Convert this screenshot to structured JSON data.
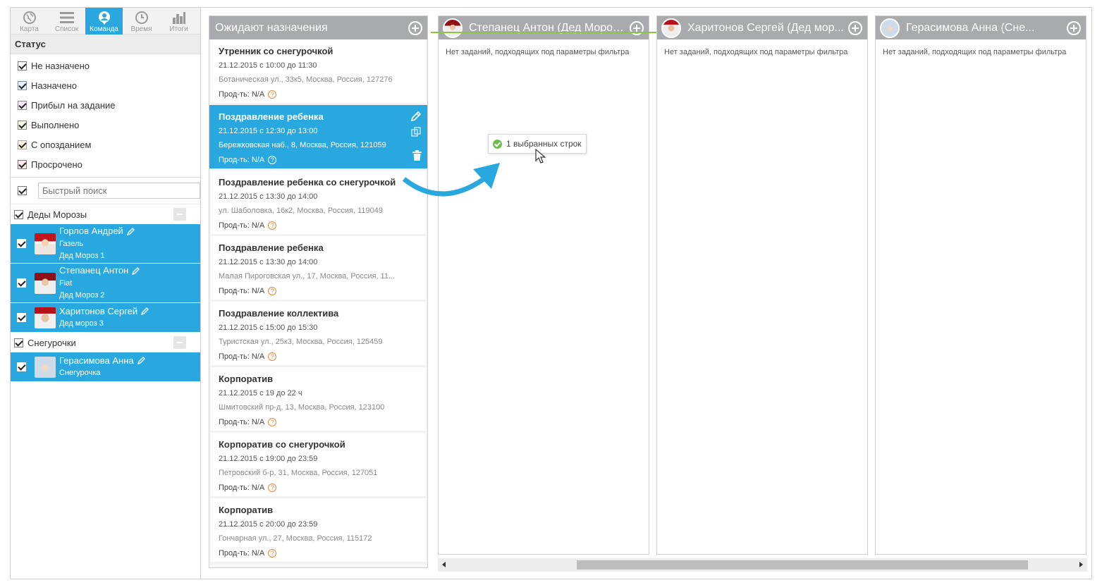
{
  "nav": [
    {
      "label": "Карта",
      "icon": "globe-icon",
      "active": false
    },
    {
      "label": "Список",
      "icon": "list-icon",
      "active": false
    },
    {
      "label": "Команда",
      "icon": "team-pin-icon",
      "active": true
    },
    {
      "label": "Время",
      "icon": "clock-icon",
      "active": false
    },
    {
      "label": "Итоги",
      "icon": "bar-chart-icon",
      "active": false
    }
  ],
  "status": {
    "title": "Статус",
    "items": [
      {
        "label": "Не назначено",
        "color": "#333333"
      },
      {
        "label": "Назначено",
        "color": "#4a9ad4"
      },
      {
        "label": "Прибыл на задание",
        "color": "#a86bbf"
      },
      {
        "label": "Выполнено",
        "color": "#63a63c"
      },
      {
        "label": "С опозданием",
        "color": "#d2a62a"
      },
      {
        "label": "Просрочено",
        "color": "#d24c4c"
      }
    ]
  },
  "search": {
    "placeholder": "Быстрый поиск"
  },
  "groups": [
    {
      "label": "Деды Морозы"
    },
    {
      "label": "Снегурочки"
    }
  ],
  "people": [
    {
      "name": "Горлов Андрей",
      "vehicle": "Газель",
      "role": "Дед Мороз 1"
    },
    {
      "name": "Степанец Антон",
      "vehicle": "Fiat",
      "role": "Дед Мороз 2"
    },
    {
      "name": "Харитонов Сергей",
      "role": "Дед мороз 3"
    },
    {
      "name": "Герасимова Анна",
      "role": "Снегурочка"
    }
  ],
  "pending": {
    "title": "Ожидают назначения",
    "productivity_prefix": "Прод-ть: N/A",
    "tasks": [
      {
        "title": "Утренник со снегурочкой",
        "date": "21.12.2015 с 10:00 до 11:30",
        "address": "Ботаническая ул., 33к5, Москва, Россия, 127276"
      },
      {
        "title": "Поздравление ребенка",
        "date": "21.12.2015 с 12:30 до 13:00",
        "address": "Бережковская наб., 8, Москва, Россия, 121059",
        "selected": true
      },
      {
        "title": "Поздравление ребенка со снегурочкой",
        "date": "21.12.2015 с 13:30 до 14:00",
        "address": "ул. Шаболовка, 16к2, Москва, Россия, 119049"
      },
      {
        "title": "Поздравление ребенка",
        "date": "21.12.2015 с 13:30 до 14:00",
        "address": "Малая Пироговская ул., 17, Москва, Россия, 11..."
      },
      {
        "title": "Поздравление коллектива",
        "date": "21.12.2015 с 15:00 до 15:30",
        "address": "Туристская ул., 25к3, Москва, Россия, 125459"
      },
      {
        "title": "Корпоратив",
        "date": "21.12.2015 с 19 до 22 ч",
        "address": "Шмитовский пр-д, 13, Москва, Россия, 123100"
      },
      {
        "title": "Корпоратив со снегурочкой",
        "date": "21.12.2015 с 19:00 до 23:59",
        "address": "Петровский б-р, 31, Москва, Россия, 127051"
      },
      {
        "title": "Корпоратив",
        "date": "21.12.2015 с 20:00 до 23:59",
        "address": "Гончарная ул., 27, Москва, Россия, 115172"
      }
    ]
  },
  "agents": [
    {
      "title": "Степанец Антон (Дед Мороз ...",
      "empty": "Нет заданий, подходящих под параметры фильтра"
    },
    {
      "title": "Харитонов Сергей (Дед мор...",
      "empty": "Нет заданий, подходящих под параметры фильтра"
    },
    {
      "title": "Герасимова Анна (Сне...",
      "empty": "Нет заданий, подходящих под параметры фильтра"
    }
  ],
  "drag": {
    "label": "1 выбранных строк"
  },
  "colors": {
    "accent": "#29a8e0",
    "header_gray": "#a9aaad",
    "drag_arrow": "#29a8e0",
    "drop_line": "#8cc63f"
  }
}
